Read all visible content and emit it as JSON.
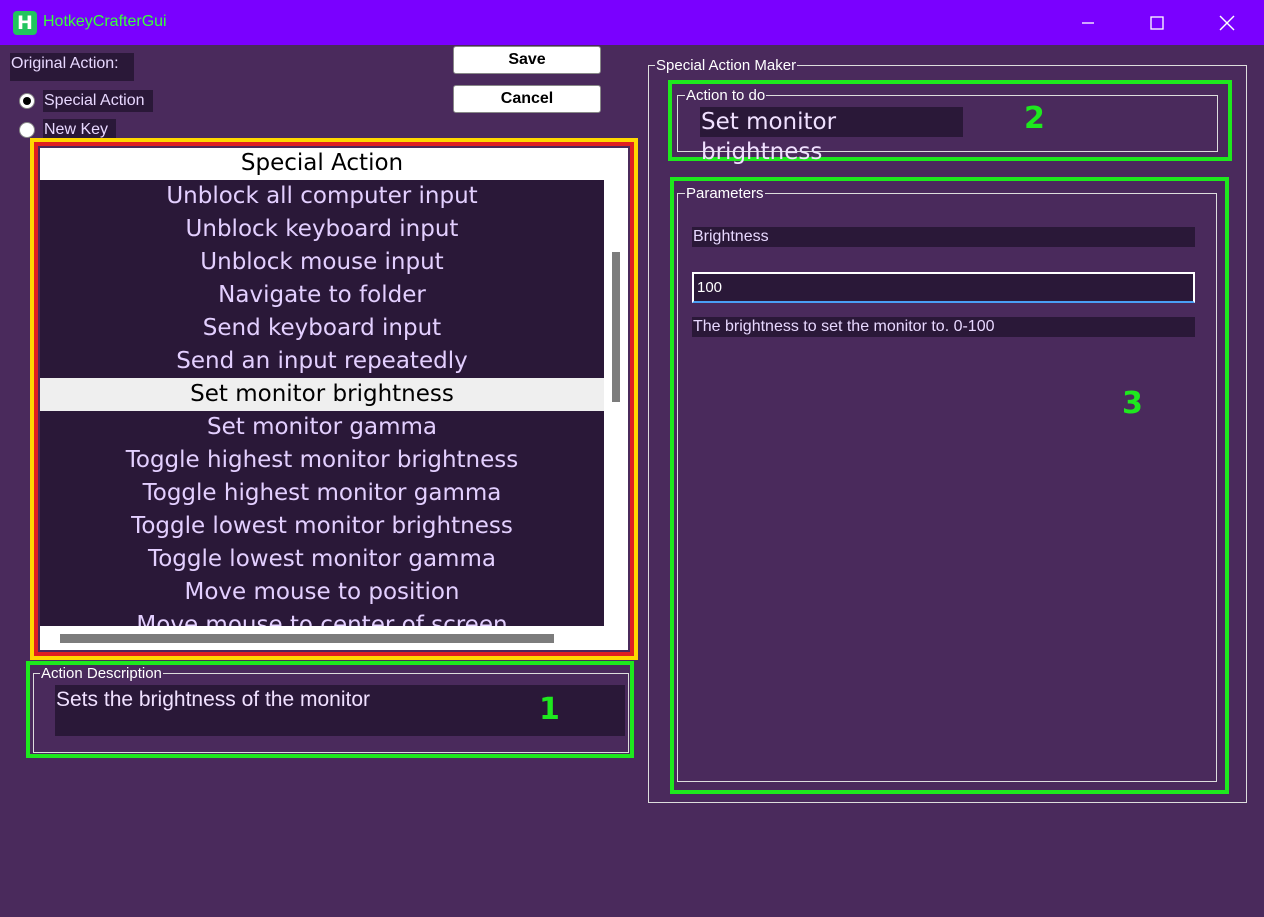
{
  "window": {
    "title": "HotkeyCrafterGui",
    "icon_letter": "H"
  },
  "original_action": {
    "label": "Original Action:",
    "options": [
      {
        "label": "Special Action",
        "selected": true
      },
      {
        "label": "New Key",
        "selected": false
      }
    ]
  },
  "buttons": {
    "save": "Save",
    "cancel": "Cancel"
  },
  "action_list": {
    "header": "Special Action",
    "items": [
      "Unblock all computer input",
      "Unblock keyboard input",
      "Unblock mouse input",
      "Navigate to folder",
      "Send keyboard input",
      "Send an input repeatedly",
      "Set monitor brightness",
      "Set monitor gamma",
      "Toggle highest monitor brightness",
      "Toggle highest monitor gamma",
      "Toggle lowest monitor brightness",
      "Toggle lowest monitor gamma",
      "Move mouse to position",
      "Move mouse to center of screen"
    ],
    "selected_index": 6
  },
  "action_description": {
    "title": "Action Description",
    "text": "Sets the brightness of the monitor"
  },
  "special_action_maker": {
    "title": "Special Action Maker",
    "action_to_do": {
      "title": "Action to do",
      "value": "Set monitor brightness"
    },
    "parameters": {
      "title": "Parameters",
      "param_label": "Brightness",
      "param_value": "100",
      "param_description": "The brightness to set the monitor to. 0-100"
    }
  },
  "annotations": {
    "marker_1": "1",
    "marker_2": "2",
    "marker_3": "3"
  },
  "colors": {
    "titlebar": "#7a00ff",
    "background": "#4a2a5c",
    "highlight_green": "#1ee81e",
    "highlight_yellow": "#ffd800",
    "highlight_red": "#e02020"
  }
}
